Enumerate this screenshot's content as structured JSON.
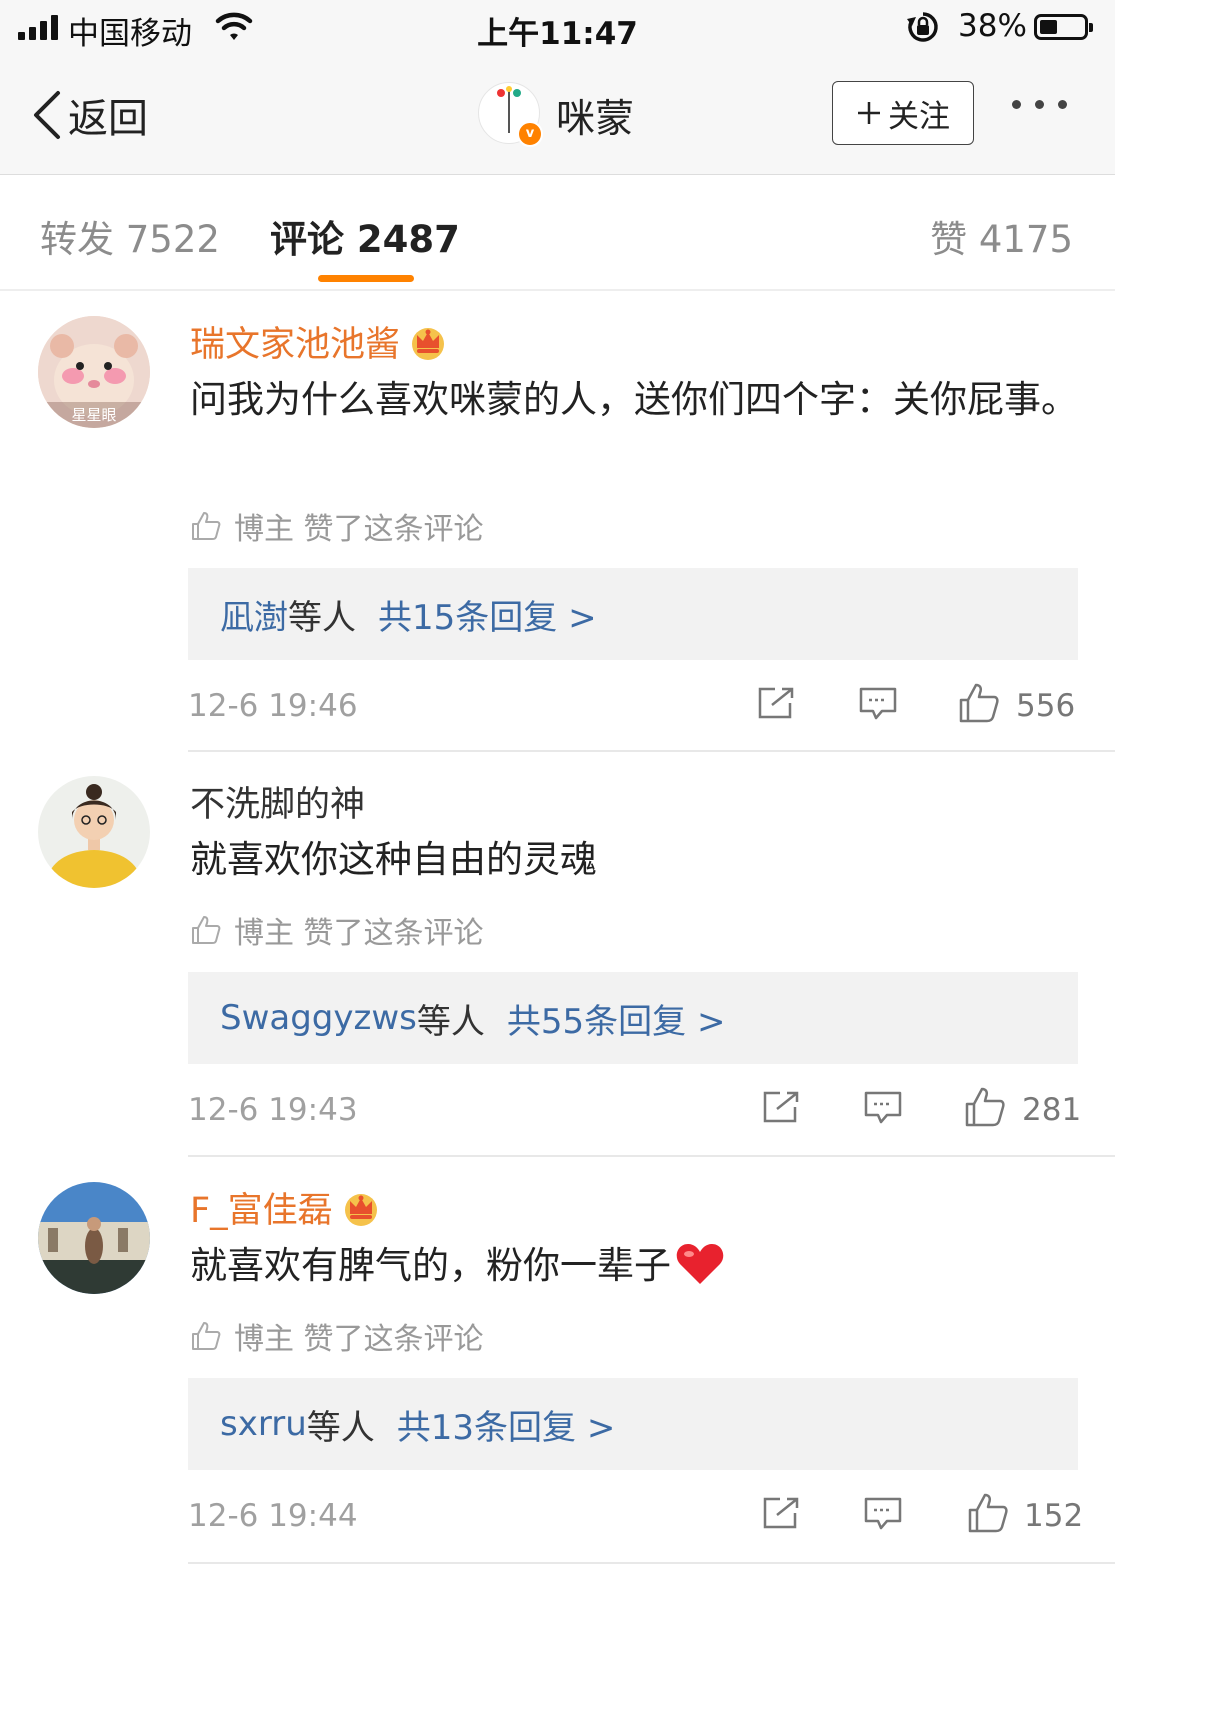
{
  "status_bar": {
    "carrier": "中国移动",
    "time": "上午11:47",
    "battery": "38%"
  },
  "nav": {
    "back_label": "返回",
    "title": "咪蒙",
    "follow_label": "关注"
  },
  "tabs": {
    "repost": "转发 7522",
    "comment": "评论 2487",
    "like": "赞 4175"
  },
  "liked_by_author_label": "博主 赞了这条评论",
  "comments": [
    {
      "username": "瑞文家池池酱",
      "avatar_text": "星星眼",
      "text": "问我为什么喜欢咪蒙的人，送你们四个字：关你屁事。",
      "reply_who": "凪澍",
      "reply_etc": "等人",
      "reply_count": "共15条回复 >",
      "time": "12-6 19:46",
      "likes": "556"
    },
    {
      "username": "不洗脚的神",
      "text": "就喜欢你这种自由的灵魂",
      "reply_who": "Swaggyzws",
      "reply_etc": "等人",
      "reply_count": "共55条回复 >",
      "time": "12-6 19:43",
      "likes": "281"
    },
    {
      "username": "F_富佳磊",
      "text": "就喜欢有脾气的，粉你一辈子",
      "reply_who": "sxrru",
      "reply_etc": "等人",
      "reply_count": "共13条回复 >",
      "time": "12-6 19:44",
      "likes": "152"
    }
  ],
  "colors": {
    "accent": "#ff8200",
    "vip_name": "#e8752b",
    "link": "#3c6aa4",
    "reply_bg": "#f2f2f2"
  }
}
